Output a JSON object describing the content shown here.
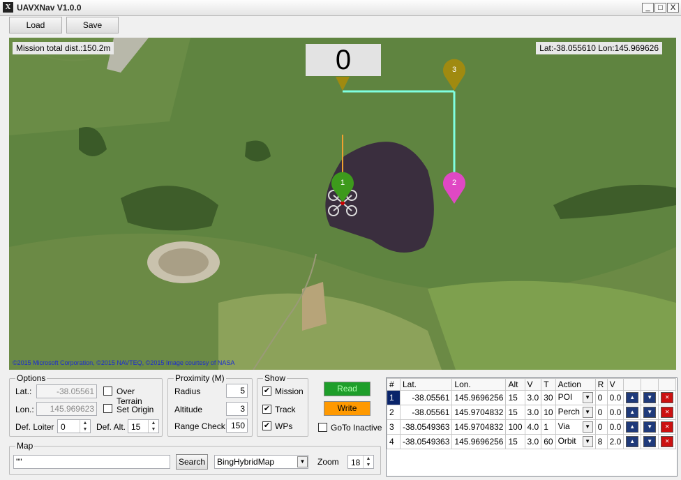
{
  "app": {
    "title": "UAVXNav  V1.0.0",
    "icon_letter": "X"
  },
  "window_controls": {
    "minimize": "_",
    "maximize": "□",
    "close": "X"
  },
  "toolbar": {
    "load_label": "Load",
    "save_label": "Save"
  },
  "map": {
    "mission_total": "Mission total dist.:150.2m",
    "coords": "Lat:-38.055610 Lon:145.969626",
    "counter": "0",
    "copyright": "©2015 Microsoft Corporation, ©2015 NAVTEQ, ©2015 Image courtesy of NASA",
    "markers": [
      {
        "num": "1",
        "color": "#3d9a1c"
      },
      {
        "num": "2",
        "color": "#e048c4"
      },
      {
        "num": "3",
        "color": "#a08a10"
      }
    ],
    "track_color": "#7fffe0",
    "heading_color": "#f0a030"
  },
  "options": {
    "legend": "Options",
    "lat_label": "Lat.:",
    "lat_value": "-38.05561",
    "lon_label": "Lon.:",
    "lon_value": "145.969623",
    "over_terrain_label": "Over Terrain",
    "set_origin_label": "Set Origin",
    "def_loiter_label": "Def. Loiter",
    "def_loiter_value": "0",
    "def_alt_label": "Def. Alt.",
    "def_alt_value": "15"
  },
  "proximity": {
    "legend": "Proximity (M)",
    "radius_label": "Radius",
    "radius_value": "5",
    "altitude_label": "Altitude",
    "altitude_value": "3",
    "range_check_label": "Range Check",
    "range_check_value": "150"
  },
  "show": {
    "legend": "Show",
    "mission_label": "Mission",
    "track_label": "Track",
    "wps_label": "WPs",
    "check_mark": "✔"
  },
  "actions": {
    "read_label": "Read",
    "write_label": "Write",
    "goto_inactive_label": "GoTo Inactive",
    "read_color": "#1e9e2a",
    "write_color": "#ff9900"
  },
  "map_panel": {
    "legend": "Map",
    "search_value": "\"\"",
    "search_button": "Search",
    "map_type": "BingHybridMap",
    "zoom_label": "Zoom",
    "zoom_value": "18"
  },
  "waypoints": {
    "headers": [
      "#",
      "Lat.",
      "Lon.",
      "Alt",
      "V",
      "T",
      "Action",
      "R",
      "V"
    ],
    "rows": [
      {
        "num": "1",
        "lat": "-38.05561",
        "lon": "145.9696256",
        "alt": "15",
        "v": "3.0",
        "t": "30",
        "action": "POI",
        "r": "0",
        "v2": "0.0"
      },
      {
        "num": "2",
        "lat": "-38.05561",
        "lon": "145.9704832",
        "alt": "15",
        "v": "3.0",
        "t": "10",
        "action": "Perch",
        "r": "0",
        "v2": "0.0"
      },
      {
        "num": "3",
        "lat": "-38.0549363",
        "lon": "145.9704832",
        "alt": "100",
        "v": "4.0",
        "t": "1",
        "action": "Via",
        "r": "0",
        "v2": "0.0"
      },
      {
        "num": "4",
        "lat": "-38.0549363",
        "lon": "145.9696256",
        "alt": "15",
        "v": "3.0",
        "t": "60",
        "action": "Orbit",
        "r": "8",
        "v2": "2.0"
      }
    ],
    "up_icon": "▲",
    "down_icon": "▼",
    "delete_icon": "✕",
    "dropdown_icon": "▼"
  }
}
